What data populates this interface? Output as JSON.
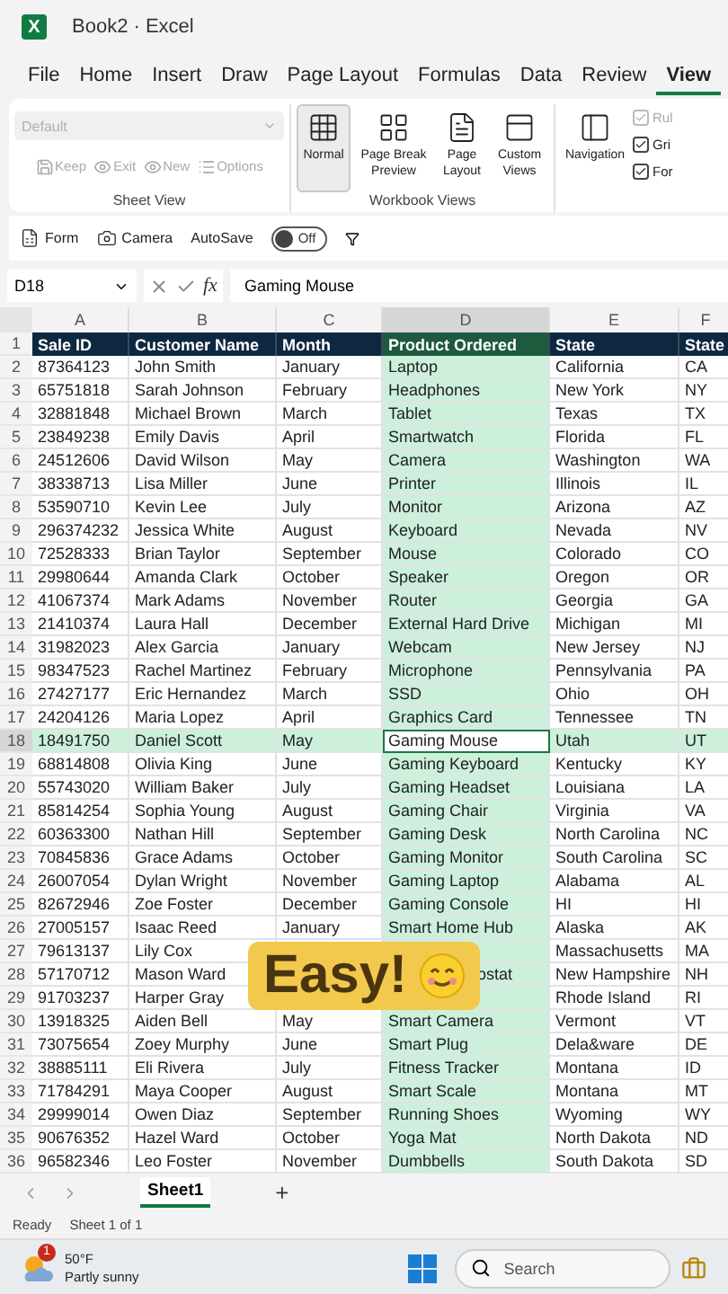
{
  "window": {
    "app_icon": "X",
    "title": "Book2 · Excel"
  },
  "menu_tabs": [
    {
      "label": "File",
      "selected": false
    },
    {
      "label": "Home",
      "selected": false
    },
    {
      "label": "Insert",
      "selected": false
    },
    {
      "label": "Draw",
      "selected": false
    },
    {
      "label": "Page Layout",
      "selected": false
    },
    {
      "label": "Formulas",
      "selected": false
    },
    {
      "label": "Data",
      "selected": false
    },
    {
      "label": "Review",
      "selected": false
    },
    {
      "label": "View",
      "selected": true
    }
  ],
  "ribbon": {
    "sheet_view": {
      "dropdown": {
        "value": "Default",
        "disabled": true
      },
      "buttons": [
        {
          "kind": "keep",
          "label": "Keep",
          "disabled": true
        },
        {
          "kind": "exit",
          "label": "Exit",
          "disabled": true
        },
        {
          "kind": "new",
          "label": "New",
          "disabled": true
        },
        {
          "kind": "options",
          "label": "Options",
          "disabled": true
        }
      ],
      "label": "Sheet View"
    },
    "workbook_views": {
      "buttons": [
        {
          "kind": "normal",
          "label": "Normal",
          "selected": true
        },
        {
          "kind": "page_break",
          "label": "Page Break Preview",
          "selected": false
        },
        {
          "kind": "page_layout",
          "label": "Page Layout",
          "selected": false
        },
        {
          "kind": "custom",
          "label": "Custom Views",
          "selected": false
        }
      ],
      "label": "Workbook Views"
    },
    "navigation": {
      "label": "Navigation"
    },
    "show": [
      {
        "label": "Rul",
        "checked": true,
        "disabled": true
      },
      {
        "label": "Gri",
        "checked": true,
        "disabled": false
      },
      {
        "label": "For",
        "checked": true,
        "disabled": false
      }
    ]
  },
  "quick_bar": {
    "items": [
      {
        "kind": "form",
        "label": "Form"
      },
      {
        "kind": "camera",
        "label": "Camera"
      }
    ],
    "autosave": {
      "label": "AutoSave",
      "on": false,
      "state_text": "Off"
    }
  },
  "formula_bar": {
    "name_box": "D18",
    "fx": "fx",
    "value": "Gaming Mouse"
  },
  "table": {
    "columns": [
      {
        "letter": "A",
        "title": "Sale ID",
        "selected": false
      },
      {
        "letter": "B",
        "title": "Customer Name",
        "selected": false
      },
      {
        "letter": "C",
        "title": "Month",
        "selected": false
      },
      {
        "letter": "D",
        "title": "Product Ordered",
        "selected": true
      },
      {
        "letter": "E",
        "title": "State",
        "selected": false
      },
      {
        "letter": "F",
        "title": "State",
        "selected": false
      }
    ],
    "header_row": "1",
    "rows": [
      {
        "n": "2",
        "selected": false,
        "cells": [
          "87364123",
          "John Smith",
          "January",
          "Laptop",
          "California",
          "CA"
        ]
      },
      {
        "n": "3",
        "selected": false,
        "cells": [
          "65751818",
          "Sarah Johnson",
          "February",
          "Headphones",
          "New York",
          "NY"
        ]
      },
      {
        "n": "4",
        "selected": false,
        "cells": [
          "32881848",
          "Michael Brown",
          "March",
          "Tablet",
          "Texas",
          "TX"
        ]
      },
      {
        "n": "5",
        "selected": false,
        "cells": [
          "23849238",
          "Emily Davis",
          "April",
          "Smartwatch",
          "Florida",
          "FL"
        ]
      },
      {
        "n": "6",
        "selected": false,
        "cells": [
          "24512606",
          "David Wilson",
          "May",
          "Camera",
          "Washington",
          "WA"
        ]
      },
      {
        "n": "7",
        "selected": false,
        "cells": [
          "38338713",
          "Lisa Miller",
          "June",
          "Printer",
          "Illinois",
          "IL"
        ]
      },
      {
        "n": "8",
        "selected": false,
        "cells": [
          "53590710",
          "Kevin Lee",
          "July",
          "Monitor",
          "Arizona",
          "AZ"
        ]
      },
      {
        "n": "9",
        "selected": false,
        "cells": [
          "296374232",
          "Jessica White",
          "August",
          "Keyboard",
          "Nevada",
          "NV"
        ]
      },
      {
        "n": "10",
        "selected": false,
        "cells": [
          "72528333",
          "Brian Taylor",
          "September",
          "Mouse",
          "Colorado",
          "CO"
        ]
      },
      {
        "n": "11",
        "selected": false,
        "cells": [
          "29980644",
          "Amanda Clark",
          "October",
          "Speaker",
          "Oregon",
          "OR"
        ]
      },
      {
        "n": "12",
        "selected": false,
        "cells": [
          "41067374",
          "Mark Adams",
          "November",
          "Router",
          "Georgia",
          "GA"
        ]
      },
      {
        "n": "13",
        "selected": false,
        "cells": [
          "21410374",
          "Laura Hall",
          "December",
          "External Hard Drive",
          "Michigan",
          "MI"
        ]
      },
      {
        "n": "14",
        "selected": false,
        "cells": [
          "31982023",
          "Alex Garcia",
          "January",
          "Webcam",
          "New Jersey",
          "NJ"
        ]
      },
      {
        "n": "15",
        "selected": false,
        "cells": [
          "98347523",
          "Rachel Martinez",
          "February",
          "Microphone",
          "Pennsylvania",
          "PA"
        ]
      },
      {
        "n": "16",
        "selected": false,
        "cells": [
          "27427177",
          "Eric Hernandez",
          "March",
          "SSD",
          "Ohio",
          "OH"
        ]
      },
      {
        "n": "17",
        "selected": false,
        "cells": [
          "24204126",
          "Maria Lopez",
          "April",
          "Graphics Card",
          "Tennessee",
          "TN"
        ]
      },
      {
        "n": "18",
        "selected": true,
        "cells": [
          "18491750",
          "Daniel Scott",
          "May",
          "Gaming Mouse",
          "Utah",
          "UT"
        ]
      },
      {
        "n": "19",
        "selected": false,
        "cells": [
          "68814808",
          "Olivia King",
          "June",
          "Gaming Keyboard",
          "Kentucky",
          "KY"
        ]
      },
      {
        "n": "20",
        "selected": false,
        "cells": [
          "55743020",
          "William Baker",
          "July",
          "Gaming Headset",
          "Louisiana",
          "LA"
        ]
      },
      {
        "n": "21",
        "selected": false,
        "cells": [
          "85814254",
          "Sophia Young",
          "August",
          "Gaming Chair",
          "Virginia",
          "VA"
        ]
      },
      {
        "n": "22",
        "selected": false,
        "cells": [
          "60363300",
          "Nathan Hill",
          "September",
          "Gaming Desk",
          "North Carolina",
          "NC"
        ]
      },
      {
        "n": "23",
        "selected": false,
        "cells": [
          "70845836",
          "Grace Adams",
          "October",
          "Gaming Monitor",
          "South Carolina",
          "SC"
        ]
      },
      {
        "n": "24",
        "selected": false,
        "cells": [
          "26007054",
          "Dylan Wright",
          "November",
          "Gaming Laptop",
          "Alabama",
          "AL"
        ]
      },
      {
        "n": "25",
        "selected": false,
        "cells": [
          "82672946",
          "Zoe Foster",
          "December",
          "Gaming Console",
          "HI",
          "HI"
        ]
      },
      {
        "n": "26",
        "selected": false,
        "cells": [
          "27005157",
          "Isaac Reed",
          "January",
          "Smart Home Hub",
          "Alaska",
          "AK"
        ]
      },
      {
        "n": "27",
        "selected": false,
        "cells": [
          "79613137",
          "Lily Cox",
          null,
          null,
          "Massachusetts",
          "MA"
        ]
      },
      {
        "n": "28",
        "selected": false,
        "cells": [
          "57170712",
          "Mason Ward",
          null,
          {
            "kind": "clipped",
            "text": "ostat"
          },
          "New Hampshire",
          "NH"
        ]
      },
      {
        "n": "29",
        "selected": false,
        "cells": [
          "91703237",
          "Harper Gray",
          null,
          null,
          "Rhode Island",
          "RI"
        ]
      },
      {
        "n": "30",
        "selected": false,
        "cells": [
          "13918325",
          "Aiden Bell",
          "May",
          "Smart Camera",
          "Vermont",
          "VT"
        ]
      },
      {
        "n": "31",
        "selected": false,
        "cells": [
          "73075654",
          "Zoey Murphy",
          "June",
          "Smart Plug",
          "Dela&ware",
          "DE"
        ]
      },
      {
        "n": "32",
        "selected": false,
        "cells": [
          "38885111",
          "Eli Rivera",
          "July",
          "Fitness Tracker",
          "Montana",
          "ID"
        ]
      },
      {
        "n": "33",
        "selected": false,
        "cells": [
          "71784291",
          "Maya Cooper",
          "August",
          "Smart Scale",
          "Montana",
          "MT"
        ]
      },
      {
        "n": "34",
        "selected": false,
        "cells": [
          "29999014",
          "Owen Diaz",
          "September",
          "Running Shoes",
          "Wyoming",
          "WY"
        ]
      },
      {
        "n": "35",
        "selected": false,
        "cells": [
          "90676352",
          "Hazel Ward",
          "October",
          "Yoga Mat",
          "North Dakota",
          "ND"
        ]
      },
      {
        "n": "36",
        "selected": false,
        "cells": [
          "96582346",
          "Leo Foster",
          "November",
          "Dumbbells",
          "South Dakota",
          "SD"
        ]
      }
    ]
  },
  "overlay": {
    "text": "Easy!"
  },
  "sheet_tabs": {
    "tabs": [
      {
        "label": "Sheet1",
        "selected": true
      }
    ],
    "add": "+"
  },
  "status_bar": {
    "mode": "Ready",
    "sheet": "Sheet 1 of 1"
  },
  "taskbar": {
    "weather": {
      "temp": "50°F",
      "condition": "Partly sunny",
      "badge": "1"
    },
    "search": {
      "placeholder": "Search"
    }
  }
}
